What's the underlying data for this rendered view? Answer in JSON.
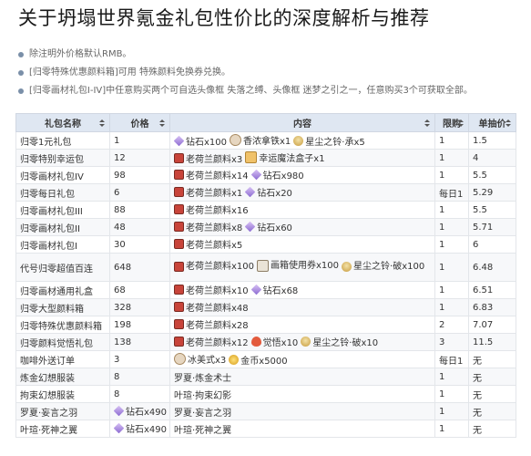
{
  "title": "关于坍塌世界氪金礼包性价比的深度解析与推荐",
  "notes": [
    "除注明外价格默认RMB。",
    "[归零特殊优惠颜料箱]可用 特殊颜料免换券兑换。",
    "[归零画材礼包I-IV]中任意购买两个可自选头像框 失落之缚、头像框 迷梦之引之一，任意购买3个可获取全部。"
  ],
  "table": {
    "headers": [
      "礼包名称",
      "价格",
      "内容",
      "限购",
      "单抽价"
    ],
    "rows": [
      {
        "name": "归零1元礼包",
        "price": "1",
        "items": [
          {
            "icon": "diamond-icon",
            "text": "钻石x100"
          },
          {
            "icon": "coffee-icon",
            "text": "香浓拿铁x1"
          },
          {
            "icon": "bell-icon",
            "text": "星尘之铃·承x5"
          }
        ],
        "limit": "1",
        "unit": "1.5"
      },
      {
        "name": "归零特别幸运包",
        "price": "12",
        "items": [
          {
            "icon": "paint-icon",
            "text": "老荷兰颜料x3"
          },
          {
            "icon": "box-icon",
            "text": "幸运魔法盒子x1"
          }
        ],
        "limit": "1",
        "unit": "4"
      },
      {
        "name": "归零画材礼包IV",
        "price": "98",
        "items": [
          {
            "icon": "paint-icon",
            "text": "老荷兰颜料x14"
          },
          {
            "icon": "diamond-icon",
            "text": "钻石x980"
          }
        ],
        "limit": "1",
        "unit": "5.5"
      },
      {
        "name": "归零每日礼包",
        "price": "6",
        "items": [
          {
            "icon": "paint-icon",
            "text": "老荷兰颜料x1"
          },
          {
            "icon": "diamond-icon",
            "text": "钻石x20"
          }
        ],
        "limit": "每日1",
        "unit": "5.29"
      },
      {
        "name": "归零画材礼包III",
        "price": "88",
        "items": [
          {
            "icon": "paint-icon",
            "text": "老荷兰颜料x16"
          }
        ],
        "limit": "1",
        "unit": "5.5"
      },
      {
        "name": "归零画材礼包II",
        "price": "48",
        "items": [
          {
            "icon": "paint-icon",
            "text": "老荷兰颜料x8"
          },
          {
            "icon": "diamond-icon",
            "text": "钻石x60"
          }
        ],
        "limit": "1",
        "unit": "5.71"
      },
      {
        "name": "归零画材礼包I",
        "price": "30",
        "items": [
          {
            "icon": "paint-icon",
            "text": "老荷兰颜料x5"
          }
        ],
        "limit": "1",
        "unit": "6"
      },
      {
        "name": "代号归零超值百连",
        "price": "648",
        "tall": true,
        "items": [
          {
            "icon": "paint-icon",
            "text": "老荷兰颜料x100"
          },
          {
            "icon": "ticket-icon",
            "text": "画箱使用券x100"
          },
          {
            "icon": "bell-icon",
            "text": "星尘之铃·破x100"
          }
        ],
        "limit": "1",
        "unit": "6.48"
      },
      {
        "name": "归零画材通用礼盒",
        "price": "68",
        "items": [
          {
            "icon": "paint-icon",
            "text": "老荷兰颜料x10"
          },
          {
            "icon": "diamond-icon",
            "text": "钻石x68"
          }
        ],
        "limit": "1",
        "unit": "6.51"
      },
      {
        "name": "归零大型颜料箱",
        "price": "328",
        "items": [
          {
            "icon": "paint-icon",
            "text": "老荷兰颜料x48"
          }
        ],
        "limit": "1",
        "unit": "6.83"
      },
      {
        "name": "归零特殊优惠颜料箱",
        "price": "198",
        "items": [
          {
            "icon": "paint-icon",
            "text": "老荷兰颜料x28"
          }
        ],
        "limit": "2",
        "unit": "7.07"
      },
      {
        "name": "归零颜料觉悟礼包",
        "price": "138",
        "items": [
          {
            "icon": "paint-icon",
            "text": "老荷兰颜料x12"
          },
          {
            "icon": "flame-icon",
            "text": "觉悟x10"
          },
          {
            "icon": "bell-icon",
            "text": "星尘之铃·破x10"
          }
        ],
        "limit": "3",
        "unit": "11.5"
      },
      {
        "name": "咖啡外送订单",
        "price": "3",
        "items": [
          {
            "icon": "coffee-icon",
            "text": "冰美式x3"
          },
          {
            "icon": "gold-icon",
            "text": "金币x5000"
          }
        ],
        "limit": "每日1",
        "unit": "无"
      },
      {
        "name": "炼金幻想服装",
        "price": "8",
        "items": [
          {
            "icon": "",
            "text": "罗夏·炼金术士"
          }
        ],
        "limit": "1",
        "unit": "无"
      },
      {
        "name": "拘束幻想服装",
        "price": "8",
        "items": [
          {
            "icon": "",
            "text": "叶瑄·拘束幻影"
          }
        ],
        "limit": "1",
        "unit": "无"
      },
      {
        "name": "罗夏·妄言之羽",
        "price": "diamond",
        "priceItem": {
          "icon": "diamond-icon",
          "text": "钻石x490"
        },
        "items": [
          {
            "icon": "",
            "text": "罗夏·妄言之羽"
          }
        ],
        "limit": "1",
        "unit": "无"
      },
      {
        "name": "叶瑄·死神之翼",
        "price": "diamond",
        "priceItem": {
          "icon": "diamond-icon",
          "text": "钻石x490"
        },
        "items": [
          {
            "icon": "",
            "text": "叶瑄·死神之翼"
          }
        ],
        "limit": "1",
        "unit": "无"
      }
    ]
  },
  "colors": {
    "header_bg": "#dfe7f2",
    "row_alt": "#f7f8fa",
    "border": "#e3e6ea"
  }
}
